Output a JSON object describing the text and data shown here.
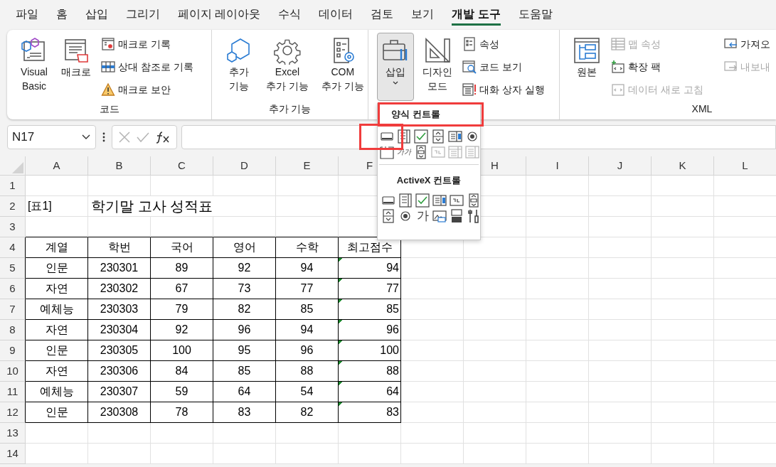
{
  "menu_tabs": [
    {
      "label": "파일",
      "selected": false
    },
    {
      "label": "홈",
      "selected": false
    },
    {
      "label": "삽입",
      "selected": false
    },
    {
      "label": "그리기",
      "selected": false
    },
    {
      "label": "페이지 레이아웃",
      "selected": false
    },
    {
      "label": "수식",
      "selected": false
    },
    {
      "label": "데이터",
      "selected": false
    },
    {
      "label": "검토",
      "selected": false
    },
    {
      "label": "보기",
      "selected": false
    },
    {
      "label": "개발 도구",
      "selected": true
    },
    {
      "label": "도움말",
      "selected": false
    }
  ],
  "ribbon": {
    "groups": [
      {
        "label": "코드",
        "items": [
          {
            "kind": "large",
            "lines": [
              "Visual",
              "Basic"
            ]
          },
          {
            "kind": "large",
            "lines": [
              "매크로"
            ]
          },
          {
            "kind": "stack",
            "entries": [
              {
                "label": "매크로 기록",
                "disabled": false
              },
              {
                "label": "상대 참조로 기록",
                "disabled": false
              },
              {
                "label": "매크로 보안",
                "disabled": false
              }
            ]
          }
        ]
      },
      {
        "label": "추가 기능",
        "items": [
          {
            "kind": "large",
            "lines": [
              "추가",
              "기능"
            ]
          },
          {
            "kind": "large",
            "lines": [
              "Excel",
              "추가 기능"
            ]
          },
          {
            "kind": "large",
            "lines": [
              "COM",
              "추가 기능"
            ]
          }
        ]
      },
      {
        "items": [
          {
            "kind": "large",
            "lines": [
              "삽입"
            ],
            "pressed": true,
            "dropdown": true
          },
          {
            "kind": "large",
            "lines": [
              "디자인",
              "모드"
            ]
          },
          {
            "kind": "stack",
            "entries": [
              {
                "label": "속성",
                "disabled": false
              },
              {
                "label": "코드 보기",
                "disabled": false
              },
              {
                "label": "대화 상자 실행",
                "disabled": false
              }
            ]
          }
        ]
      },
      {
        "label": "XML",
        "items": [
          {
            "kind": "large",
            "lines": [
              "원본"
            ]
          },
          {
            "kind": "stack",
            "entries": [
              {
                "label": "맵 속성",
                "disabled": true
              },
              {
                "label": "확장 팩",
                "disabled": false
              },
              {
                "label": "데이터 새로 고침",
                "disabled": true
              }
            ]
          },
          {
            "kind": "stack",
            "entries": [
              {
                "label": "가져오",
                "disabled": false
              },
              {
                "label": "내보내",
                "disabled": true
              }
            ]
          }
        ]
      }
    ]
  },
  "formula_bar": {
    "name_box": "N17"
  },
  "insert_menu": {
    "sections": [
      {
        "title": "양식 컨트롤",
        "highlighted": true,
        "controls": [
          {
            "kind": "button",
            "disabled": false,
            "highlighted": true
          },
          {
            "kind": "combo",
            "disabled": false,
            "highlighted": false
          },
          {
            "kind": "checkbox",
            "disabled": false,
            "highlighted": false
          },
          {
            "kind": "spin",
            "disabled": false,
            "highlighted": false
          },
          {
            "kind": "listbox",
            "disabled": false,
            "highlighted": false
          },
          {
            "kind": "option",
            "disabled": false,
            "highlighted": false
          },
          {
            "kind": "groupbox",
            "disabled": false,
            "highlighted": false
          },
          {
            "kind": "label",
            "text": "가가",
            "disabled": false,
            "highlighted": false
          },
          {
            "kind": "scrollbar",
            "disabled": false,
            "highlighted": false
          },
          {
            "kind": "textfield",
            "disabled": true,
            "highlighted": false
          },
          {
            "kind": "combolist",
            "disabled": true,
            "highlighted": false
          },
          {
            "kind": "combodrop",
            "disabled": true,
            "highlighted": false
          }
        ]
      },
      {
        "title": "ActiveX 컨트롤",
        "highlighted": false,
        "controls": [
          {
            "kind": "button",
            "disabled": false,
            "highlighted": false
          },
          {
            "kind": "combo",
            "disabled": false,
            "highlighted": false
          },
          {
            "kind": "checkbox",
            "disabled": false,
            "highlighted": false
          },
          {
            "kind": "listbox",
            "disabled": false,
            "highlighted": false
          },
          {
            "kind": "textfield",
            "disabled": false,
            "highlighted": false
          },
          {
            "kind": "scrollbar",
            "disabled": false,
            "highlighted": false
          },
          {
            "kind": "spin",
            "disabled": false,
            "highlighted": false
          },
          {
            "kind": "option",
            "disabled": false,
            "highlighted": false
          },
          {
            "kind": "label",
            "text": "가",
            "disabled": false,
            "highlighted": false
          },
          {
            "kind": "image",
            "disabled": false,
            "highlighted": false
          },
          {
            "kind": "toggle",
            "disabled": false,
            "highlighted": false
          },
          {
            "kind": "more",
            "disabled": false,
            "highlighted": false
          }
        ]
      }
    ]
  },
  "sheet": {
    "columns": [
      "A",
      "B",
      "C",
      "D",
      "E",
      "F",
      "H",
      "I",
      "J",
      "K",
      "L"
    ],
    "row_numbers": [
      "1",
      "2",
      "3",
      "4",
      "5",
      "6",
      "7",
      "8",
      "9",
      "10",
      "11",
      "12",
      "13",
      "14"
    ],
    "label": "[표1]",
    "title": "학기말 고사 성적표",
    "table": {
      "header": [
        "계열",
        "학번",
        "국어",
        "영어",
        "수학",
        "최고점수"
      ],
      "rows": [
        {
          "cells": [
            "인문",
            "230301",
            "89",
            "92",
            "94",
            "94"
          ],
          "flagged": true
        },
        {
          "cells": [
            "자연",
            "230302",
            "67",
            "73",
            "77",
            "77"
          ],
          "flagged": true
        },
        {
          "cells": [
            "예체능",
            "230303",
            "79",
            "82",
            "85",
            "85"
          ],
          "flagged": true
        },
        {
          "cells": [
            "자연",
            "230304",
            "92",
            "96",
            "94",
            "96"
          ],
          "flagged": true
        },
        {
          "cells": [
            "인문",
            "230305",
            "100",
            "95",
            "96",
            "100"
          ],
          "flagged": true
        },
        {
          "cells": [
            "자연",
            "230306",
            "84",
            "85",
            "88",
            "88"
          ],
          "flagged": true
        },
        {
          "cells": [
            "예체능",
            "230307",
            "59",
            "64",
            "54",
            "64"
          ],
          "flagged": true
        },
        {
          "cells": [
            "인문",
            "230308",
            "78",
            "83",
            "82",
            "83"
          ],
          "flagged": true
        }
      ]
    }
  }
}
